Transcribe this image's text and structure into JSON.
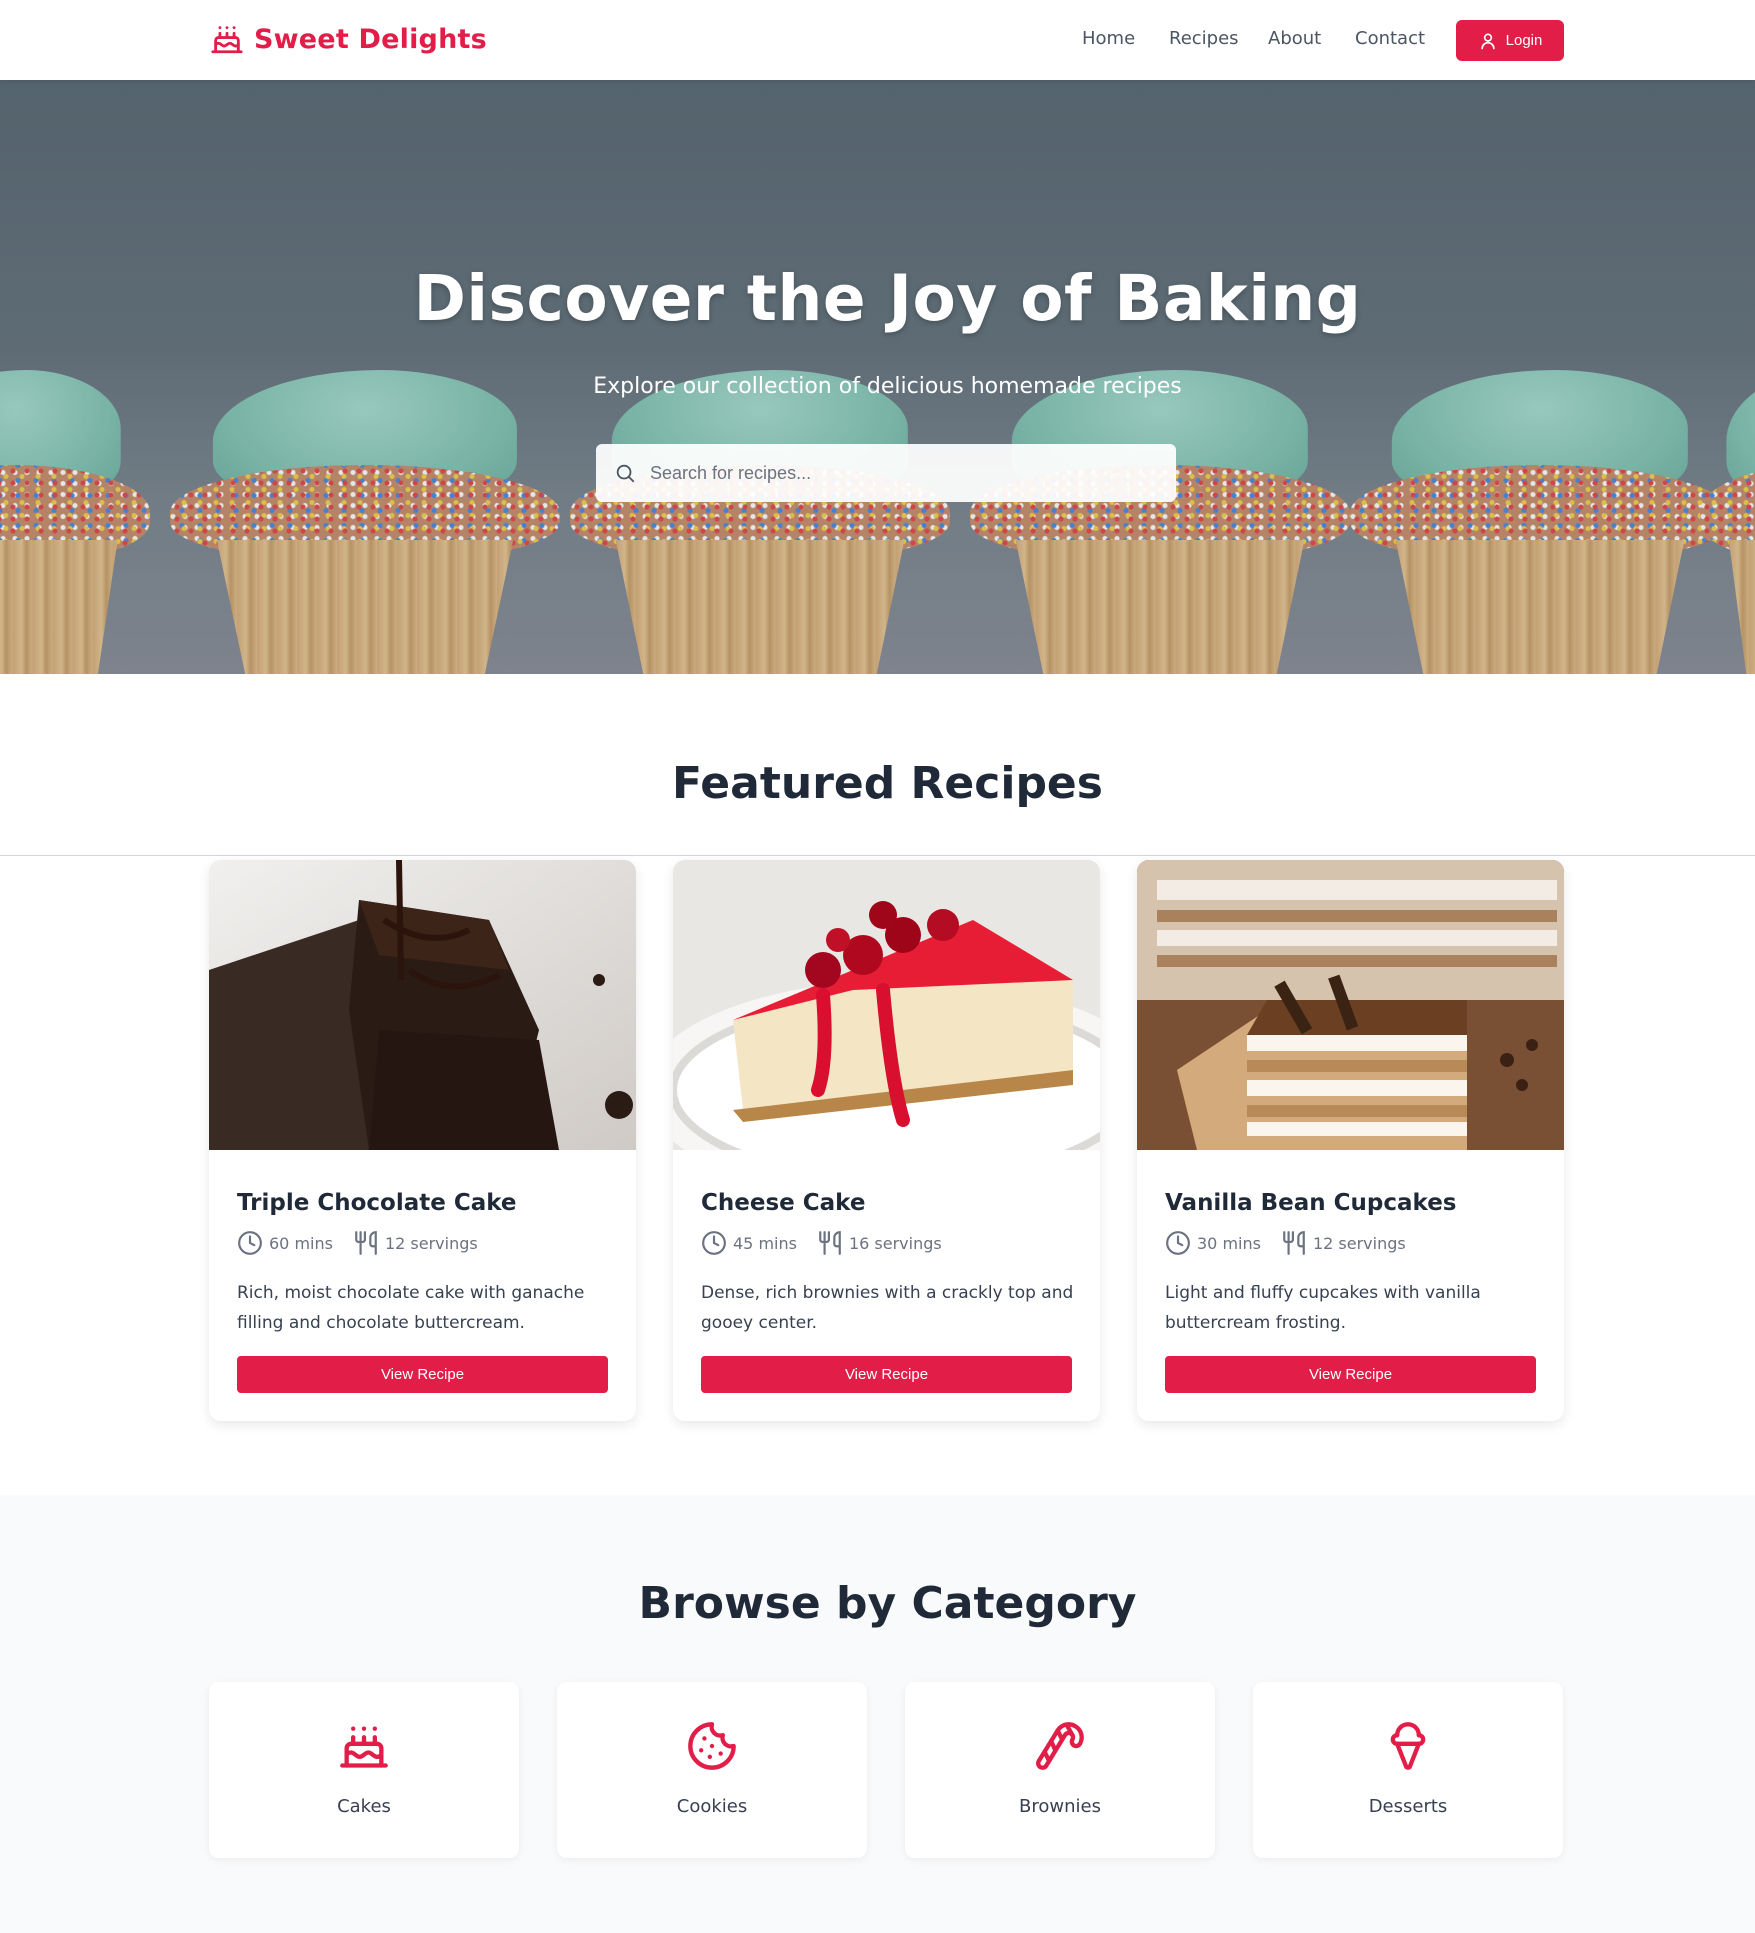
{
  "brand": {
    "name": "Sweet Delights",
    "accent": "#e11d48"
  },
  "nav": {
    "items": [
      "Home",
      "Recipes",
      "About",
      "Contact"
    ],
    "login_label": "Login"
  },
  "hero": {
    "title": "Discover the Joy of Baking",
    "subtitle": "Explore our collection of delicious homemade recipes",
    "search_placeholder": "Search for recipes..."
  },
  "featured": {
    "title": "Featured Recipes",
    "recipes": [
      {
        "title": "Triple Chocolate Cake",
        "time": "60 mins",
        "servings": "12 servings",
        "description": "Rich, moist chocolate cake with ganache filling and chocolate buttercream.",
        "button": "View Recipe"
      },
      {
        "title": "Cheese Cake",
        "time": "45 mins",
        "servings": "16 servings",
        "description": "Dense, rich brownies with a crackly top and gooey center.",
        "button": "View Recipe"
      },
      {
        "title": "Vanilla Bean Cupcakes",
        "time": "30 mins",
        "servings": "12 servings",
        "description": "Light and fluffy cupcakes with vanilla buttercream frosting.",
        "button": "View Recipe"
      }
    ]
  },
  "categories": {
    "title": "Browse by Category",
    "items": [
      {
        "label": "Cakes",
        "icon": "cake-icon"
      },
      {
        "label": "Cookies",
        "icon": "cookie-icon"
      },
      {
        "label": "Brownies",
        "icon": "candy-cane-icon"
      },
      {
        "label": "Desserts",
        "icon": "ice-cream-icon"
      }
    ]
  }
}
